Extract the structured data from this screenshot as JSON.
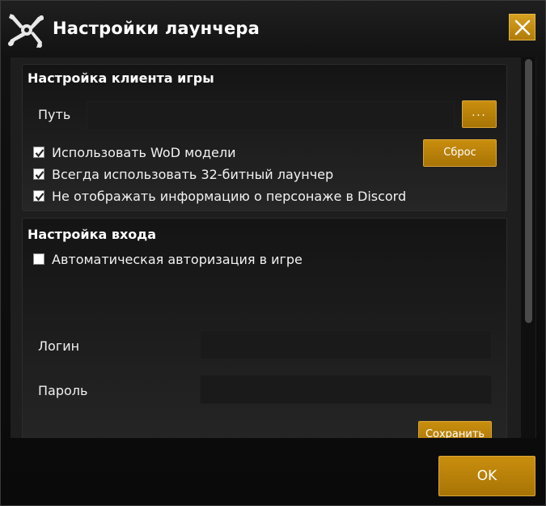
{
  "window": {
    "title": "Настройки лаунчера",
    "logo_icon": "wow-circle-logo-icon",
    "close_icon": "close-icon"
  },
  "client_section": {
    "title": "Настройка клиента игры",
    "path_label": "Путь",
    "path_value": "",
    "browse_label": "...",
    "reset_label": "Сброс",
    "options": [
      {
        "label": "Использовать WoD модели",
        "checked": true
      },
      {
        "label": "Всегда использовать 32-битный лаунчер",
        "checked": true
      },
      {
        "label": "Не отображать информацию о персонаже в Discord",
        "checked": true
      }
    ]
  },
  "login_section": {
    "title": "Настройка входа",
    "auto_login_label": "Автоматическая авторизация в игре",
    "auto_login_checked": false,
    "login_label": "Логин",
    "login_value": "",
    "password_label": "Пароль",
    "password_value": "",
    "save_label": "Сохранить"
  },
  "footer": {
    "ok_label": "OK"
  },
  "colors": {
    "accent": "#b8830a",
    "background": "#0b0b0b",
    "panel": "#1e1e1e"
  }
}
